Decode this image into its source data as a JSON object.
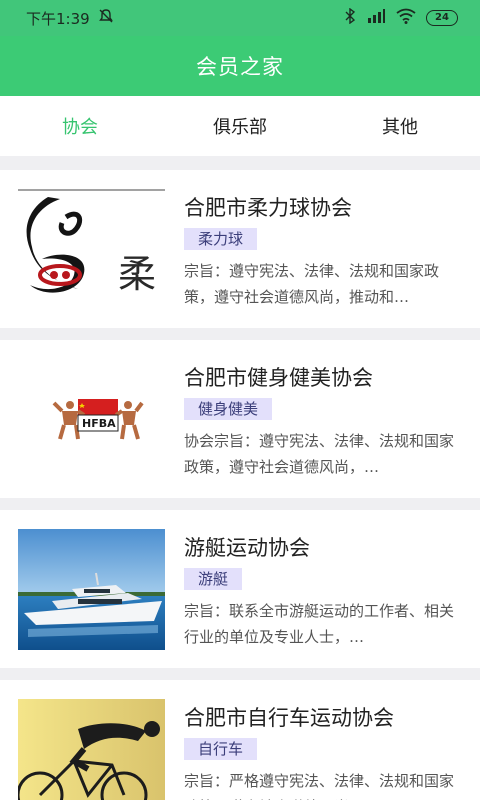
{
  "status_bar": {
    "time": "下午1:39",
    "battery": "24",
    "icons": [
      "mute-bell-icon",
      "bluetooth-icon",
      "signal-icon",
      "wifi-icon",
      "battery-icon"
    ]
  },
  "app_bar": {
    "title": "会员之家"
  },
  "tabs": [
    {
      "label": "协会",
      "active": true
    },
    {
      "label": "俱乐部",
      "active": false
    },
    {
      "label": "其他",
      "active": false
    }
  ],
  "colors": {
    "accent": "#3ccb75",
    "tag_bg": "#e3e0fb",
    "tag_text": "#3b3e7a"
  },
  "items": [
    {
      "title": "合肥市柔力球协会",
      "tag": "柔力球",
      "desc": "宗旨：遵守宪法、法律、法规和国家政策，遵守社会道德风尚，推动和…",
      "thumb_text": "柔"
    },
    {
      "title": "合肥市健身健美协会",
      "tag": "健身健美",
      "desc": "协会宗旨：遵守宪法、法律、法规和国家政策，遵守社会道德风尚，…",
      "thumb_text": "HFBA"
    },
    {
      "title": "游艇运动协会",
      "tag": "游艇",
      "desc": "宗旨：联系全市游艇运动的工作者、相关行业的单位及专业人士，…"
    },
    {
      "title": "合肥市自行车运动协会",
      "tag": "自行车",
      "desc": "宗旨：严格遵守宪法、法律、法规和国家政策，遵守社会道德风尚，…"
    }
  ]
}
